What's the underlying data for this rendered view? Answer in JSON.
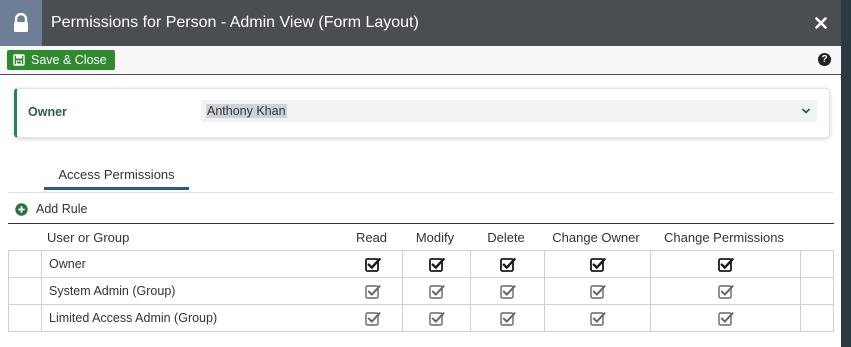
{
  "window": {
    "title": "Permissions for Person - Admin View (Form Layout)",
    "lock_icon": "lock-icon",
    "close_icon": "close-icon"
  },
  "toolbar": {
    "save_label": "Save & Close",
    "help_label": "?"
  },
  "owner": {
    "label": "Owner",
    "value": "Anthony Khan"
  },
  "tabs": [
    {
      "label": "Access Permissions",
      "active": true
    }
  ],
  "add_rule_label": "Add Rule",
  "grid": {
    "columns": [
      "User or Group",
      "Read",
      "Modify",
      "Delete",
      "Change Owner",
      "Change Permissions"
    ],
    "rows": [
      {
        "name": "Owner",
        "read": true,
        "modify": true,
        "delete": true,
        "change_owner": true,
        "change_permissions": true,
        "style": "bold"
      },
      {
        "name": "System Admin (Group)",
        "read": true,
        "modify": true,
        "delete": true,
        "change_owner": true,
        "change_permissions": true,
        "style": "muted"
      },
      {
        "name": "Limited Access Admin (Group)",
        "read": true,
        "modify": true,
        "delete": true,
        "change_owner": true,
        "change_permissions": true,
        "style": "muted"
      }
    ]
  },
  "colors": {
    "titlebar": "#4a4d52",
    "lock_box": "#6d7f96",
    "save_button": "#2f8a2f",
    "owner_accent": "#2e7d5b",
    "tab_underline": "#2b5797"
  }
}
